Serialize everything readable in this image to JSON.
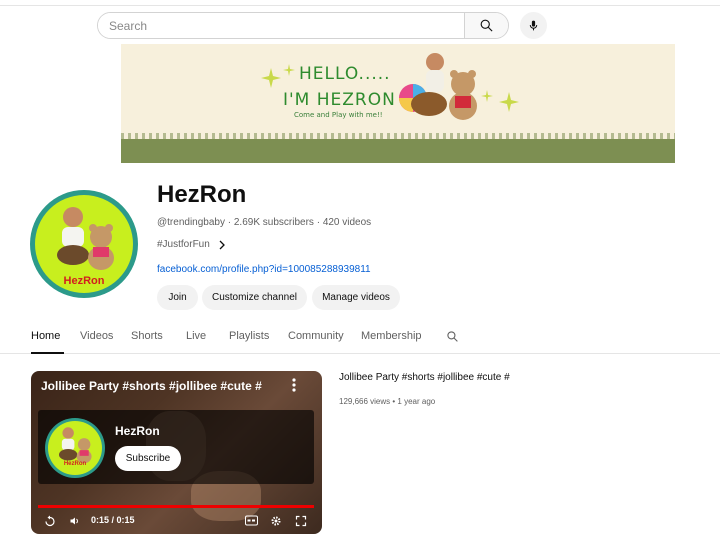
{
  "search": {
    "placeholder": "Search"
  },
  "banner": {
    "line1": "HELLO.....",
    "line2": "I'M  HEZRON",
    "line3": "Come and Play with me!!"
  },
  "channel": {
    "name": "HezRon",
    "avatar_label": "HezRon",
    "handle": "@trendingbaby",
    "subscribers": "2.69K subscribers",
    "videos": "420 videos",
    "description": "#JustforFun",
    "link": "facebook.com/profile.php?id=100085288939811",
    "buttons": {
      "join": "Join",
      "customize": "Customize channel",
      "manage": "Manage videos"
    }
  },
  "tabs": [
    "Home",
    "Videos",
    "Shorts",
    "Live",
    "Playlists",
    "Community",
    "Membership"
  ],
  "active_tab": "Home",
  "featured_video": {
    "title": "Jollibee Party #shorts #jollibee #cute #",
    "endcard": {
      "name": "HezRon",
      "subscribe": "Subscribe",
      "avatar_label": "HezRon"
    },
    "time": "0:15 / 0:15",
    "progress_fraction": 1.0,
    "views": "129,666 views",
    "age": "1 year ago"
  },
  "colors": {
    "link": "#065fd4",
    "progress": "#ee0000",
    "avatar_ring": "#2c9a8a",
    "avatar_bg": "#c8ef1e"
  },
  "icons": [
    "search-icon",
    "mic-icon",
    "chevron-right-icon",
    "tab-search-icon",
    "more-vert-icon",
    "replay-icon",
    "volume-icon",
    "captions-icon",
    "settings-icon",
    "fullscreen-icon"
  ]
}
